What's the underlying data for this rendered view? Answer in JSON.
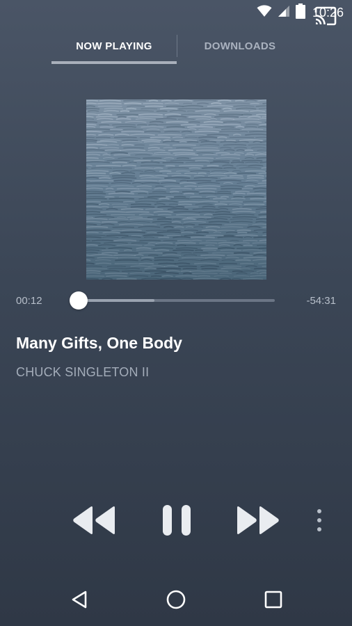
{
  "status_bar": {
    "time": "10:26",
    "icons": [
      "wifi-icon",
      "cell-signal-icon",
      "battery-icon"
    ]
  },
  "tabs": [
    {
      "label": "NOW PLAYING",
      "active": true
    },
    {
      "label": "DOWNLOADS",
      "active": false
    }
  ],
  "cast": {
    "icon": "cast-icon"
  },
  "album_art": {
    "description_icon": "ocean-water-artwork"
  },
  "player": {
    "elapsed": "00:12",
    "remaining": "-54:31",
    "progress_fraction": 0.004,
    "buffered_fraction": 0.39
  },
  "track": {
    "title": "Many Gifts, One Body",
    "artist": "CHUCK SINGLETON II"
  },
  "controls": {
    "rewind_icon": "rewind-icon",
    "pause_icon": "pause-icon",
    "forward_icon": "fast-forward-icon",
    "more_icon": "more-vert-icon"
  },
  "nav": {
    "back_icon": "back-icon",
    "home_icon": "home-icon",
    "recents_icon": "recents-icon"
  },
  "colors": {
    "background_top": "#4a5566",
    "background_bottom": "#2f3846",
    "accent": "#ffffff",
    "muted_text": "#a4adba"
  }
}
